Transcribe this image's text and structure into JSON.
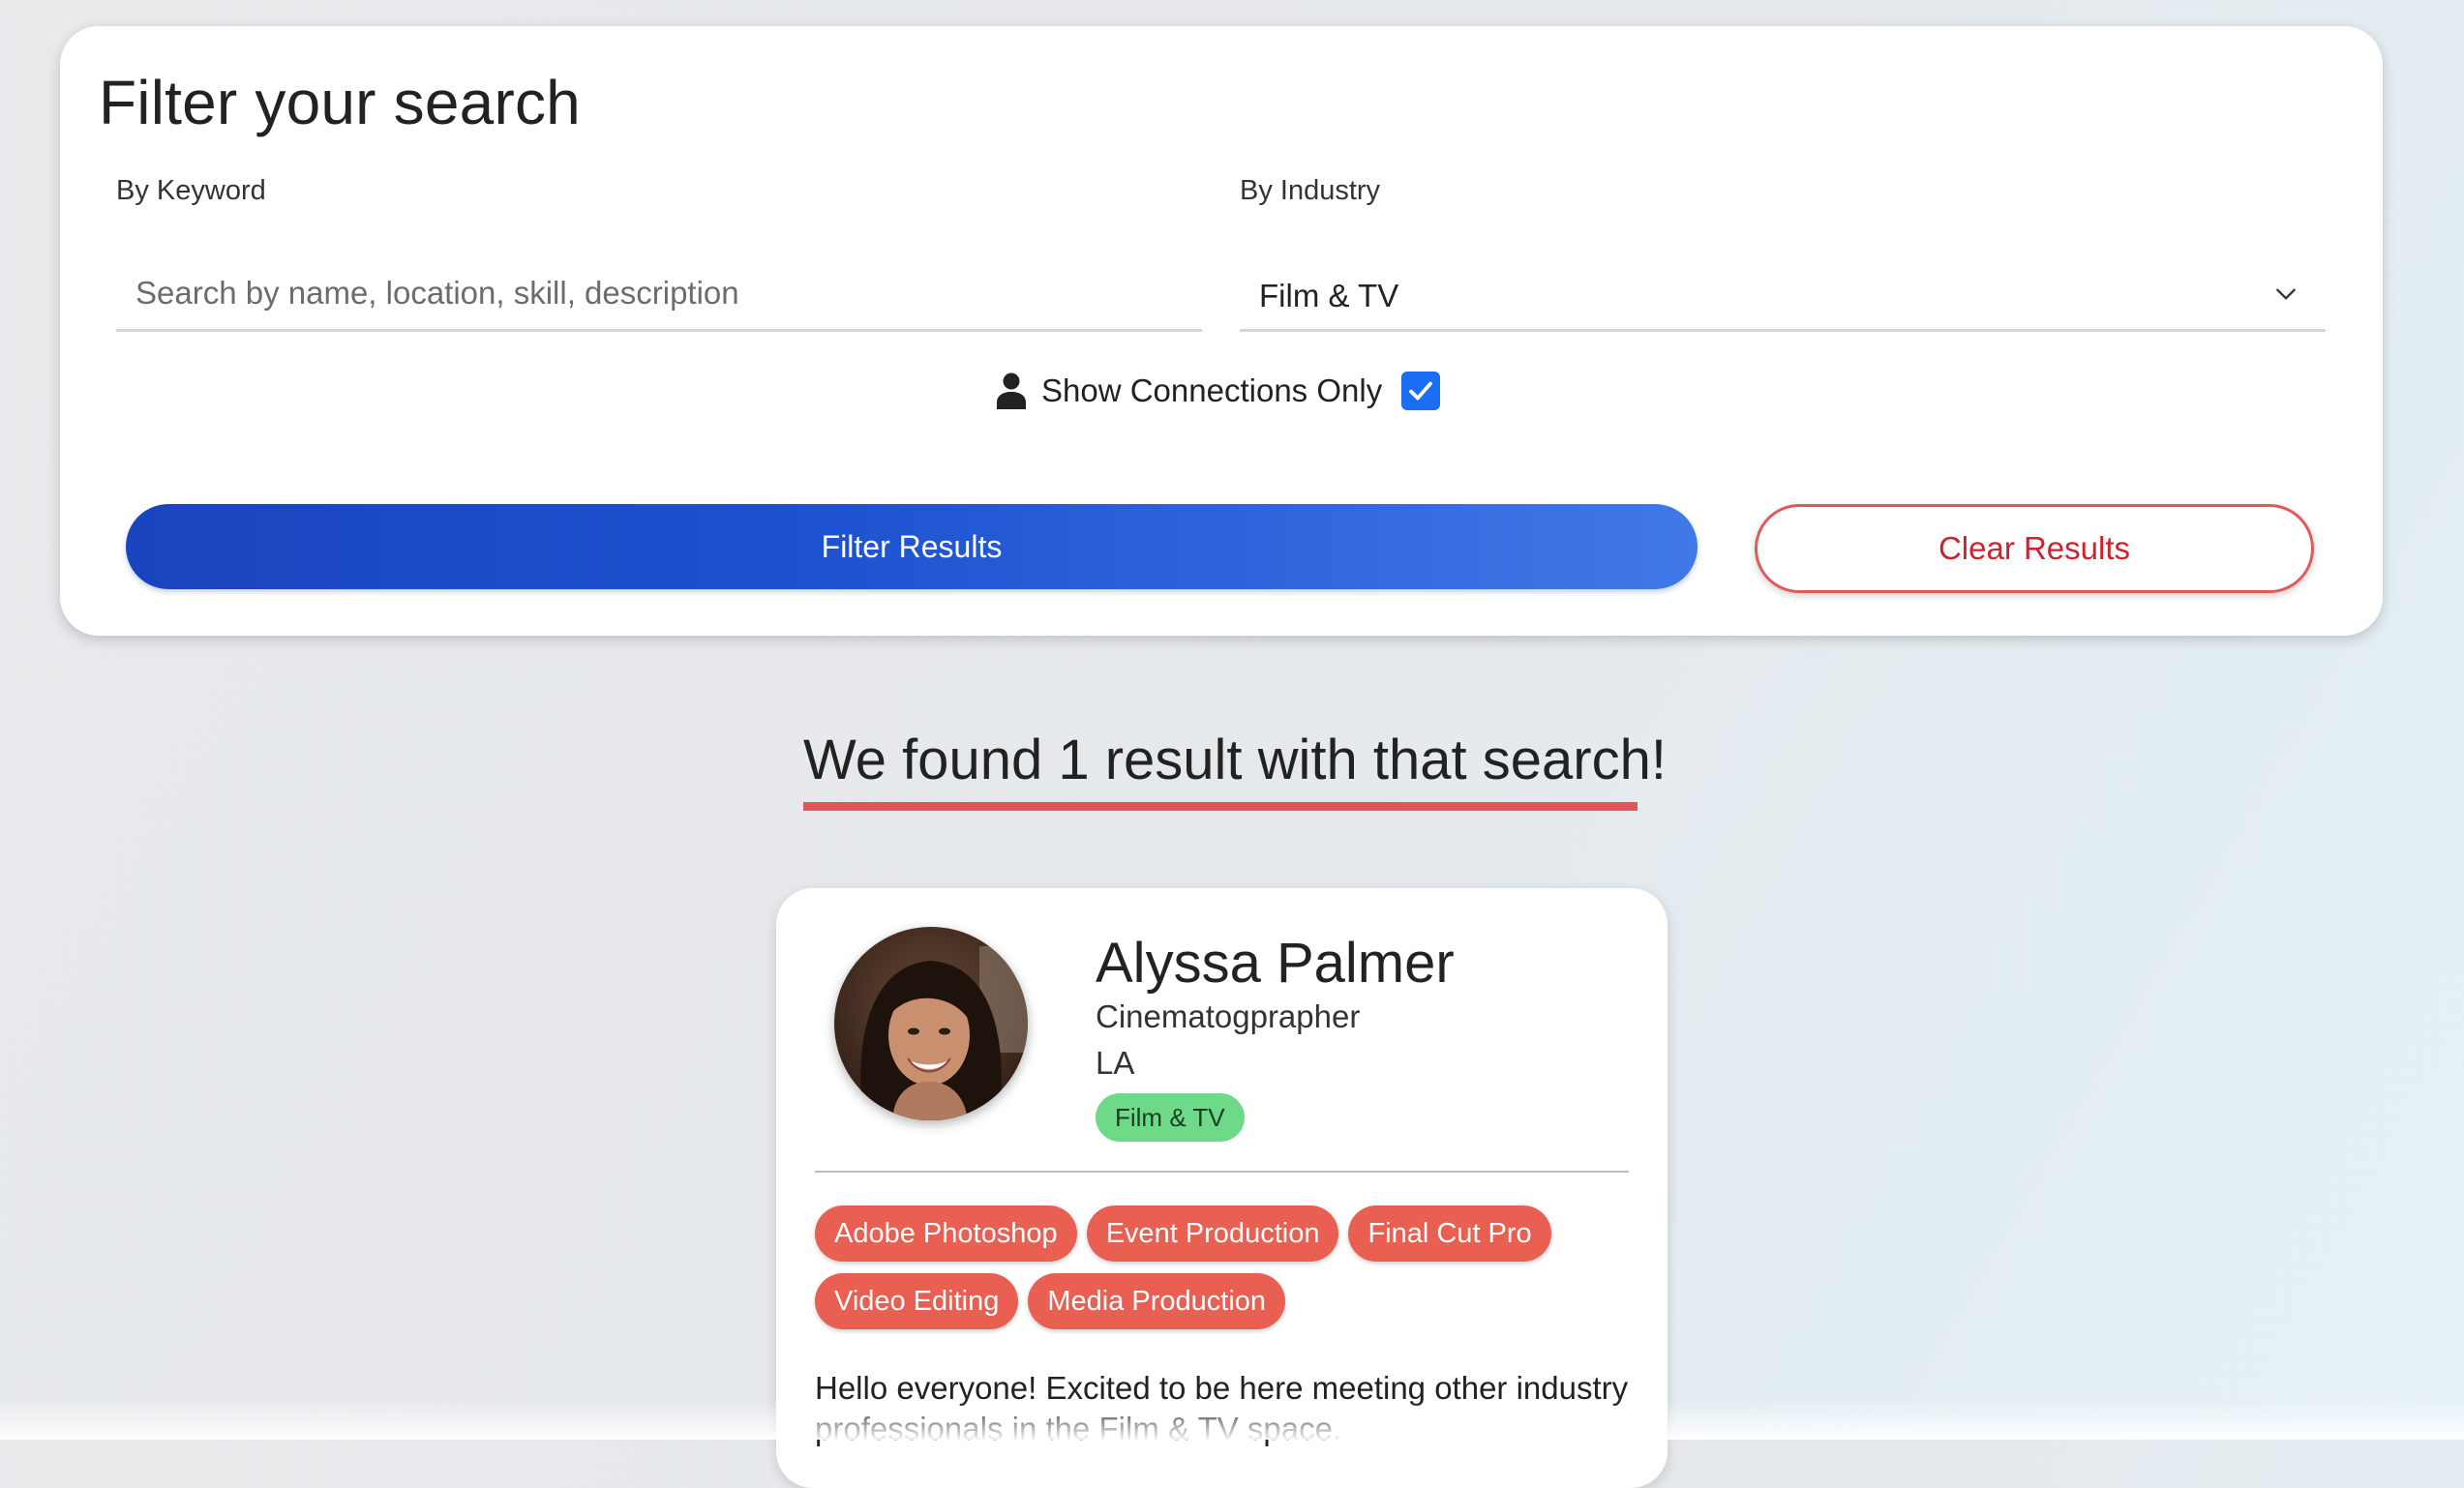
{
  "filter": {
    "title": "Filter your search",
    "keyword_label": "By Keyword",
    "keyword_placeholder": "Search by name, location, skill, description",
    "keyword_value": "",
    "industry_label": "By Industry",
    "industry_selected": "Film & TV",
    "connections_label": "Show Connections Only",
    "connections_checked": true,
    "filter_button_label": "Filter Results",
    "clear_button_label": "Clear Results"
  },
  "results": {
    "heading": "We found 1 result with that search!"
  },
  "profile": {
    "name": "Alyssa Palmer",
    "title": "Cinematogprapher",
    "location": "LA",
    "industry": "Film & TV",
    "skills_row1": [
      "Adobe Photoshop",
      "Event Production",
      "Final Cut Pro"
    ],
    "skills_row2": [
      "Video Editing",
      "Media Production"
    ],
    "bio": "Hello everyone! Excited to be here meeting other industry professionals in the Film & TV space."
  },
  "colors": {
    "primary_blue": "#1a44bd",
    "clear_red": "#cc2330",
    "skill_tag": "#e95f52",
    "industry_badge": "#6fd98a",
    "checkbox": "#1b6ef3"
  }
}
